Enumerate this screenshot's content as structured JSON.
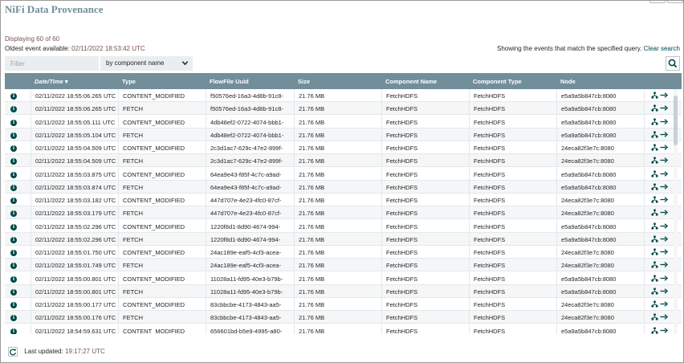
{
  "title": "NiFi Data Provenance",
  "summary": {
    "displaying": "Displaying 60 of 60",
    "oldest_label": "Oldest event available:",
    "oldest_value": "02/11/2022 18:53:42 UTC",
    "showing_text": "Showing the events that match the specified query.",
    "clear_search": "Clear search"
  },
  "filter": {
    "placeholder": "Filter",
    "by_option": "by component name"
  },
  "columns": [
    "Date/Time",
    "Type",
    "FlowFile Uuid",
    "Size",
    "Component Name",
    "Component Type",
    "Node"
  ],
  "sort_column": "Date/Time",
  "rows": [
    {
      "date": "02/11/2022 18:55:06.265 UTC",
      "type": "CONTENT_MODIFIED",
      "uuid": "f50576ed-16a3-4d8b-91c8-",
      "size": "21.76 MB",
      "component": "FetchHDFS",
      "ctype": "FetchHDFS",
      "node": "e5a9a5b847cb:8080"
    },
    {
      "date": "02/11/2022 18:55:06.265 UTC",
      "type": "FETCH",
      "uuid": "f50576ed-16a3-4d8b-91c8-",
      "size": "21.76 MB",
      "component": "FetchHDFS",
      "ctype": "FetchHDFS",
      "node": "e5a9a5b847cb:8080"
    },
    {
      "date": "02/11/2022 18:55:05.111 UTC",
      "type": "CONTENT_MODIFIED",
      "uuid": "4db48ef2-0722-4074-bbb1-",
      "size": "21.76 MB",
      "component": "FetchHDFS",
      "ctype": "FetchHDFS",
      "node": "e5a9a5b847cb:8080"
    },
    {
      "date": "02/11/2022 18:55:05.104 UTC",
      "type": "FETCH",
      "uuid": "4db48ef2-0722-4074-bbb1-",
      "size": "21.76 MB",
      "component": "FetchHDFS",
      "ctype": "FetchHDFS",
      "node": "e5a9a5b847cb:8080"
    },
    {
      "date": "02/11/2022 18:55:04.509 UTC",
      "type": "CONTENT_MODIFIED",
      "uuid": "2c3d1ac7-629c-47e2-899f-",
      "size": "21.76 MB",
      "component": "FetchHDFS",
      "ctype": "FetchHDFS",
      "node": "24eca82f3e7c:8080"
    },
    {
      "date": "02/11/2022 18:55:04.509 UTC",
      "type": "FETCH",
      "uuid": "2c3d1ac7-629c-47e2-899f-",
      "size": "21.76 MB",
      "component": "FetchHDFS",
      "ctype": "FetchHDFS",
      "node": "24eca82f3e7c:8080"
    },
    {
      "date": "02/11/2022 18:55:03.875 UTC",
      "type": "CONTENT_MODIFIED",
      "uuid": "64ea9e43-f85f-4c7c-a9ad-",
      "size": "21.76 MB",
      "component": "FetchHDFS",
      "ctype": "FetchHDFS",
      "node": "e5a9a5b847cb:8080"
    },
    {
      "date": "02/11/2022 18:55:03.874 UTC",
      "type": "FETCH",
      "uuid": "64ea9e43-f85f-4c7c-a9ad-",
      "size": "21.76 MB",
      "component": "FetchHDFS",
      "ctype": "FetchHDFS",
      "node": "e5a9a5b847cb:8080"
    },
    {
      "date": "02/11/2022 18:55:03.182 UTC",
      "type": "CONTENT_MODIFIED",
      "uuid": "447d707e-4e23-4fc0-87cf-",
      "size": "21.76 MB",
      "component": "FetchHDFS",
      "ctype": "FetchHDFS",
      "node": "24eca82f3e7c:8080"
    },
    {
      "date": "02/11/2022 18:55:03.179 UTC",
      "type": "FETCH",
      "uuid": "447d707e-4e23-4fc0-87cf-",
      "size": "21.76 MB",
      "component": "FetchHDFS",
      "ctype": "FetchHDFS",
      "node": "24eca82f3e7c:8080"
    },
    {
      "date": "02/11/2022 18:55:02.296 UTC",
      "type": "CONTENT_MODIFIED",
      "uuid": "1220f8d1-8d90-4674-994-",
      "size": "21.76 MB",
      "component": "FetchHDFS",
      "ctype": "FetchHDFS",
      "node": "e5a9a5b847cb:8080"
    },
    {
      "date": "02/11/2022 18:55:02.296 UTC",
      "type": "FETCH",
      "uuid": "1220f8d1-8d90-4674-994-",
      "size": "21.76 MB",
      "component": "FetchHDFS",
      "ctype": "FetchHDFS",
      "node": "e5a9a5b847cb:8080"
    },
    {
      "date": "02/11/2022 18:55:01.750 UTC",
      "type": "CONTENT_MODIFIED",
      "uuid": "24ac189e-eaf5-4cf3-acea-",
      "size": "21.76 MB",
      "component": "FetchHDFS",
      "ctype": "FetchHDFS",
      "node": "24eca82f3e7c:8080"
    },
    {
      "date": "02/11/2022 18:55:01.749 UTC",
      "type": "FETCH",
      "uuid": "24ac189e-eaf5-4cf3-acea-",
      "size": "21.76 MB",
      "component": "FetchHDFS",
      "ctype": "FetchHDFS",
      "node": "24eca82f3e7c:8080"
    },
    {
      "date": "02/11/2022 18:55:00.801 UTC",
      "type": "CONTENT_MODIFIED",
      "uuid": "11028a11-fd95-40e3-b79b-",
      "size": "21.76 MB",
      "component": "FetchHDFS",
      "ctype": "FetchHDFS",
      "node": "e5a9a5b847cb:8080"
    },
    {
      "date": "02/11/2022 18:55:00.801 UTC",
      "type": "FETCH",
      "uuid": "11028a11-fd95-40e3-b79b-",
      "size": "21.76 MB",
      "component": "FetchHDFS",
      "ctype": "FetchHDFS",
      "node": "e5a9a5b847cb:8080"
    },
    {
      "date": "02/11/2022 18:55:00.177 UTC",
      "type": "CONTENT_MODIFIED",
      "uuid": "83cbbcbe-4173-4843-aa5-",
      "size": "21.76 MB",
      "component": "FetchHDFS",
      "ctype": "FetchHDFS",
      "node": "24eca82f3e7c:8080"
    },
    {
      "date": "02/11/2022 18:55:00.176 UTC",
      "type": "FETCH",
      "uuid": "83cbbcbe-4173-4843-aa5-",
      "size": "21.76 MB",
      "component": "FetchHDFS",
      "ctype": "FetchHDFS",
      "node": "24eca82f3e7c:8080"
    },
    {
      "date": "02/11/2022 18:54:59.631 UTC",
      "type": "CONTENT_MODIFIED",
      "uuid": "656601bd-b5e9-4995-a80-",
      "size": "21.76 MB",
      "component": "FetchHDFS",
      "ctype": "FetchHDFS",
      "node": "e5a9a5b847cb:8080"
    }
  ],
  "footer": {
    "label": "Last updated:",
    "time": "19:17:27 UTC"
  },
  "colors": {
    "header": "#728e9b",
    "title": "#728e9b",
    "accent": "#004849",
    "value": "#775351"
  },
  "icons": {
    "row_info": "info-circle-icon",
    "row_lineage": "lineage-icon",
    "row_goto": "arrow-right-icon",
    "search": "search-icon",
    "refresh": "refresh-icon",
    "sort": "sort-desc-icon",
    "dropdown": "chevron-down-icon"
  }
}
